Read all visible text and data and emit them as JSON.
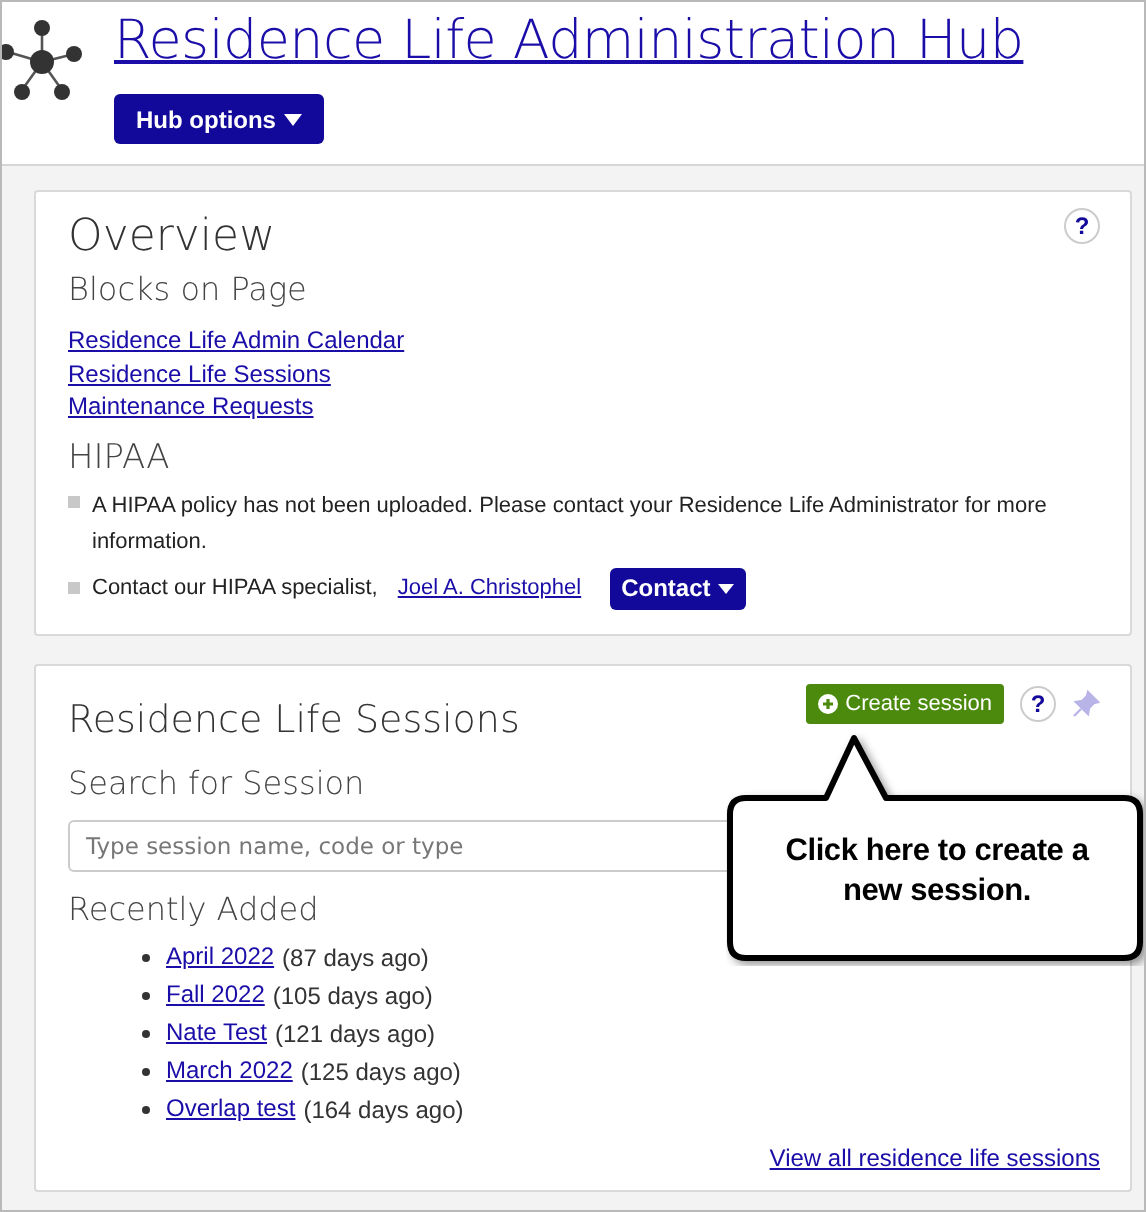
{
  "header": {
    "title": "Residence Life Administration Hub",
    "menu_button": "Hub options"
  },
  "overview": {
    "title": "Overview",
    "help": "?",
    "subtitle": "Blocks on Page",
    "links": [
      "Residence Life Admin Calendar",
      "Residence Life Sessions",
      "Maintenance Requests"
    ],
    "hipaa_heading": "HIPAA",
    "notes": [
      {
        "kind": "text",
        "text": "A HIPAA policy has not been uploaded. Please contact your Residence Life Administrator for more information."
      },
      {
        "kind": "contact",
        "text": "Contact our HIPAA specialist,",
        "link": "Joel A. Christophel",
        "button": "Contact"
      }
    ]
  },
  "sessions": {
    "title": "Residence Life Sessions",
    "create_button": "Create session",
    "help": "?",
    "search_label": "Search for Session",
    "search": {
      "placeholder": "Type session name, code or type"
    },
    "recent_heading": "Recently Added",
    "recent": [
      {
        "name": "April 2022",
        "age": "(87 days ago)"
      },
      {
        "name": "Fall 2022",
        "age": "(105 days ago)"
      },
      {
        "name": "Nate Test",
        "age": "(121 days ago)"
      },
      {
        "name": "March 2022",
        "age": "(125 days ago)"
      },
      {
        "name": "Overlap test",
        "age": "(164 days ago)"
      }
    ],
    "view_all": "View all residence life sessions"
  },
  "callout": {
    "text": "Click here to create a new session."
  }
}
